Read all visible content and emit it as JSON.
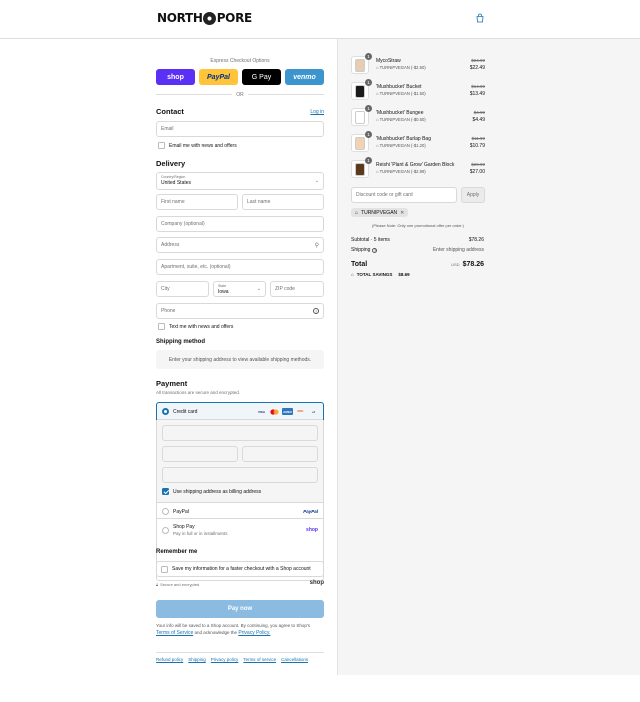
{
  "brand": {
    "logo_left": "NORTH",
    "logo_right": "PORE"
  },
  "express": {
    "title": "Express Checkout Options",
    "shop": "shop",
    "paypal": "PayPal",
    "gpay": "G Pay",
    "venmo": "venmo",
    "or": "OR"
  },
  "contact": {
    "title": "Contact",
    "login": "Log in",
    "email_placeholder": "Email",
    "newsletter": "Email me with news and offers"
  },
  "delivery": {
    "title": "Delivery",
    "country_label": "Country/Region",
    "country_value": "United States",
    "first_name": "First name",
    "last_name": "Last name",
    "company": "Company (optional)",
    "address": "Address",
    "apartment": "Apartment, suite, etc. (optional)",
    "city": "City",
    "state_label": "State",
    "state_value": "Iowa",
    "zip": "ZIP code",
    "phone": "Phone",
    "text_me": "Text me with news and offers"
  },
  "shipping": {
    "title": "Shipping method",
    "message": "Enter your shipping address to view available shipping methods."
  },
  "payment": {
    "title": "Payment",
    "subtitle": "All transactions are secure and encrypted.",
    "credit_card": "Credit card",
    "card_logos": [
      "VISA",
      "MC",
      "AMEX",
      "DISC",
      "+6"
    ],
    "billing_same": "Use shipping address as billing address",
    "paypal": "PayPal",
    "paypal_logo": "PayPal",
    "shop_pay": "Shop Pay",
    "shop_pay_sub": "Pay in full or in installments",
    "shop_pay_logo": "shop"
  },
  "remember": {
    "title": "Remember me",
    "save_info": "Save my information for a faster checkout with a Shop account",
    "secure": "Secure and encrypted",
    "shop_logo": "shop"
  },
  "pay_now": "Pay now",
  "terms": {
    "text": "Your info will be saved to a Shop account. By continuing, you agree to Shop's",
    "tos": "Terms of Service",
    "and": "and acknowledge the",
    "privacy": "Privacy Policy."
  },
  "footer": [
    "Refund policy",
    "Shipping",
    "Privacy policy",
    "Terms of service",
    "Cancellations"
  ],
  "cart": {
    "items": [
      {
        "qty": "1",
        "name": "MycoStraw",
        "code": "TURNIPVEGAN (-$2.50)",
        "old": "$24.99",
        "price": "$22.49",
        "color": "#e8cdb5"
      },
      {
        "qty": "1",
        "name": "'Mushbucket' Bucket",
        "code": "TURNIPVEGAN (-$1.50)",
        "old": "$14.99",
        "price": "$13.49",
        "color": "#1a1a1a"
      },
      {
        "qty": "1",
        "name": "'Mushbucket' Bungee",
        "code": "TURNIPVEGAN (-$0.50)",
        "old": "$4.99",
        "price": "$4.49",
        "color": "#ffffff"
      },
      {
        "qty": "1",
        "name": "'Mushbucket' Burlap Bag",
        "code": "TURNIPVEGAN (-$1.20)",
        "old": "$11.99",
        "price": "$10.79",
        "color": "#f0d2b4"
      },
      {
        "qty": "1",
        "name": "Reishi 'Plant & Grow' Garden Block",
        "code": "TURNIPVEGAN (-$2.99)",
        "old": "$29.99",
        "price": "$27.00",
        "color": "#5a3a18"
      }
    ],
    "discount_placeholder": "Discount code or gift card",
    "apply": "Apply",
    "code_tag": "TURNIPVEGAN",
    "note": "(Please Note: Only one promotional offer per order.)",
    "subtotal_label": "Subtotal · 5 items",
    "subtotal_value": "$78.26",
    "shipping_label": "Shipping",
    "shipping_value": "Enter shipping address",
    "total_label": "Total",
    "currency": "USD",
    "total_value": "$78.26",
    "savings_label": "TOTAL SAVINGS",
    "savings_value": "$8.69"
  }
}
